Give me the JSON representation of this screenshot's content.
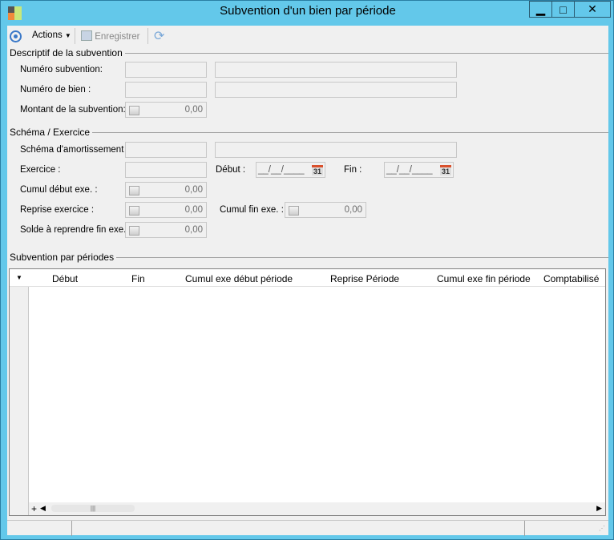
{
  "window": {
    "title": "Subvention d'un bien par période"
  },
  "toolbar": {
    "actions": "Actions",
    "save": "Enregistrer"
  },
  "descriptif": {
    "title": "Descriptif de la subvention",
    "numero_subvention": "Numéro subvention:",
    "numero_bien": "Numéro de bien :",
    "montant": "Montant de la subvention:",
    "montant_value": "0,00"
  },
  "schema": {
    "title": "Schéma / Exercice",
    "schema_amort": "Schéma d'amortissement :",
    "exercice": "Exercice :",
    "debut": "Début :",
    "debut_value": "__/__/____",
    "fin": "Fin :",
    "fin_value": "__/__/____",
    "calendar": "31",
    "cumul_debut": "Cumul début exe. :",
    "cumul_debut_value": "0,00",
    "reprise": "Reprise exercice :",
    "reprise_value": "0,00",
    "cumul_fin": "Cumul fin exe. :",
    "cumul_fin_value": "0,00",
    "solde": "Solde à reprendre fin exe. :",
    "solde_value": "0,00"
  },
  "grid": {
    "title": "Subvention par périodes",
    "columns": [
      "Début",
      "Fin",
      "Cumul exe début période",
      "Reprise Période",
      "Cumul exe fin période",
      "Comptabilisé"
    ],
    "add": "+"
  }
}
